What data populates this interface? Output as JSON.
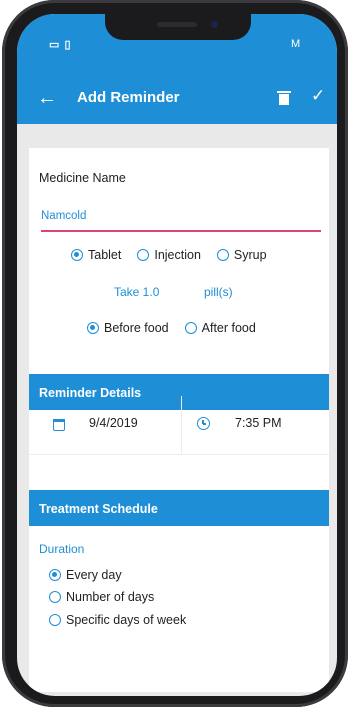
{
  "status": {
    "left": "▭ ▯",
    "right": "M"
  },
  "header": {
    "title": "Add Reminder",
    "back_icon": "arrow-left-icon",
    "delete_icon": "trash-icon",
    "save_icon": "check-icon"
  },
  "medicine": {
    "label": "Medicine Name",
    "value": "Namcold"
  },
  "form_types": [
    {
      "label": "Tablet",
      "selected": true
    },
    {
      "label": "Injection",
      "selected": false
    },
    {
      "label": "Syrup",
      "selected": false
    }
  ],
  "dose": {
    "take": "Take 1.0",
    "unit": "pill(s)"
  },
  "food": [
    {
      "label": "Before food",
      "selected": true
    },
    {
      "label": "After food",
      "selected": false
    }
  ],
  "reminder": {
    "title": "Reminder Details",
    "date": "9/4/2019",
    "time": "7:35 PM"
  },
  "schedule": {
    "title": "Treatment Schedule",
    "duration_label": "Duration",
    "options": [
      {
        "label": "Every day",
        "selected": true
      },
      {
        "label": "Number of days",
        "selected": false
      },
      {
        "label": "Specific days of week",
        "selected": false
      }
    ]
  },
  "colors": {
    "accent": "#1e8fd6",
    "underline": "#d7457c"
  }
}
